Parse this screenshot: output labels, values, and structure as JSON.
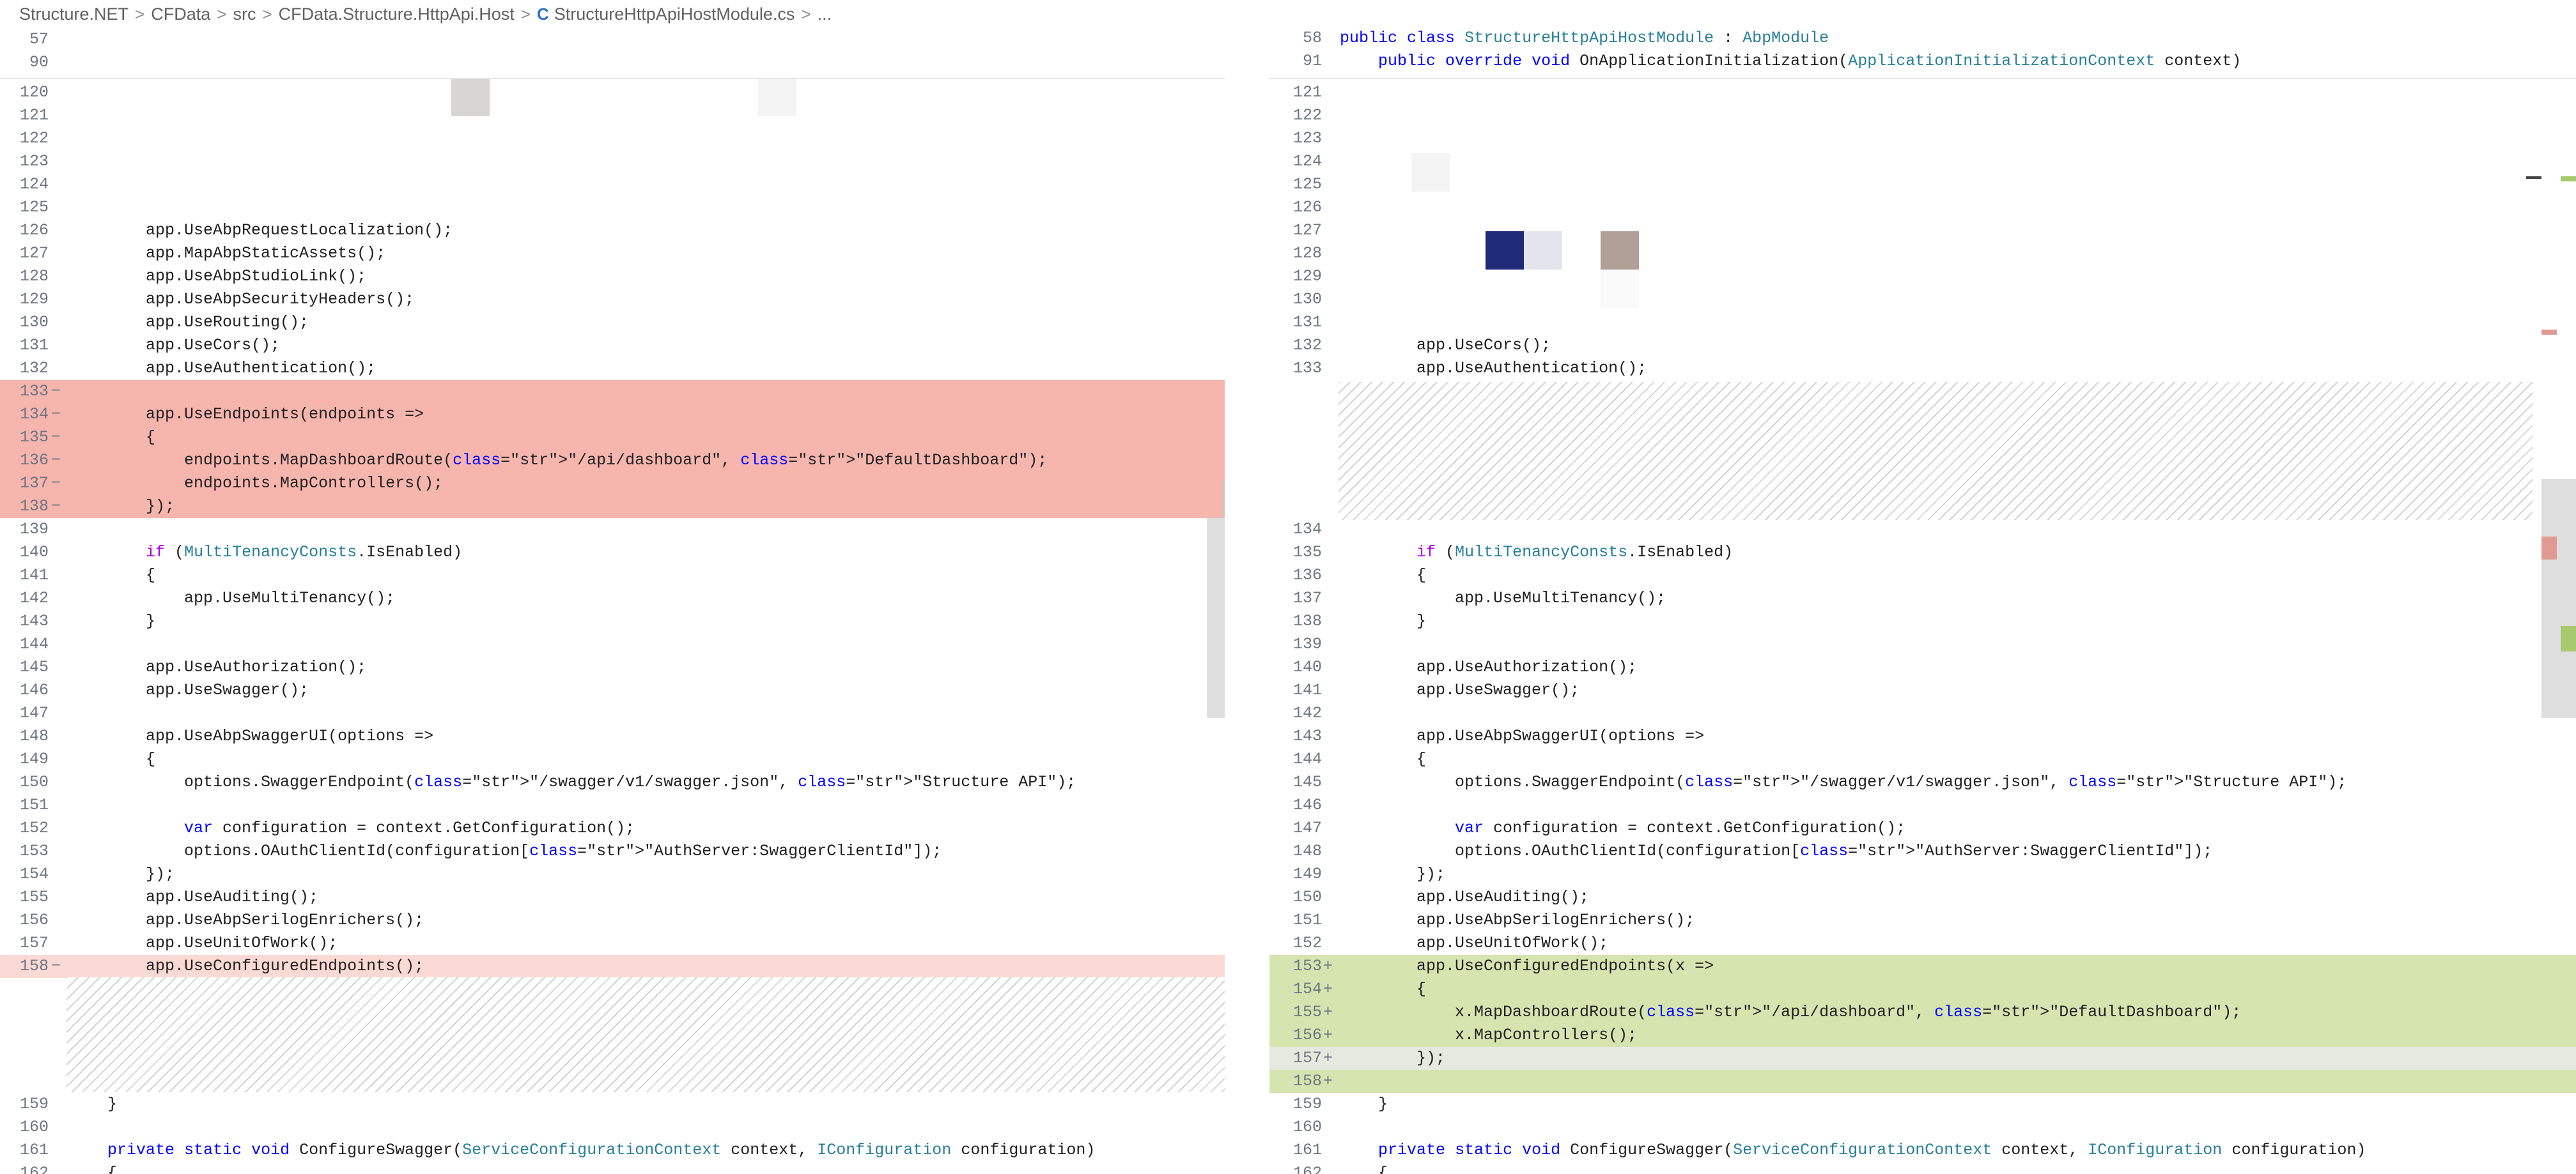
{
  "breadcrumb": {
    "items": [
      "Structure.NET",
      "CFData",
      "src",
      "CFData.Structure.HttpApi.Host",
      "StructureHttpApiHostModule.cs",
      "..."
    ],
    "separator": ">"
  },
  "left": {
    "sticky": [
      {
        "ln": "57",
        "text": ""
      },
      {
        "ln": "90",
        "text": ""
      }
    ],
    "lines": [
      {
        "ln": "120",
        "text": ""
      },
      {
        "ln": "121",
        "text": ""
      },
      {
        "ln": "122",
        "text": ""
      },
      {
        "ln": "123",
        "text": ""
      },
      {
        "ln": "124",
        "text": ""
      },
      {
        "ln": "125",
        "text": ""
      },
      {
        "ln": "126",
        "text": "        app.UseAbpRequestLocalization();"
      },
      {
        "ln": "127",
        "text": "        app.MapAbpStaticAssets();"
      },
      {
        "ln": "128",
        "text": "        app.UseAbpStudioLink();"
      },
      {
        "ln": "129",
        "text": "        app.UseAbpSecurityHeaders();"
      },
      {
        "ln": "130",
        "text": "        app.UseRouting();"
      },
      {
        "ln": "131",
        "text": "        app.UseCors();"
      },
      {
        "ln": "132",
        "text": "        app.UseAuthentication();"
      },
      {
        "ln": "133",
        "mark": "−",
        "text": "",
        "diff": "del"
      },
      {
        "ln": "134",
        "mark": "−",
        "text": "        app.UseEndpoints(endpoints =>",
        "diff": "del"
      },
      {
        "ln": "135",
        "mark": "−",
        "text": "        {",
        "diff": "del"
      },
      {
        "ln": "136",
        "mark": "−",
        "text": "            endpoints.MapDashboardRoute(\"/api/dashboard\", \"DefaultDashboard\");",
        "diff": "del"
      },
      {
        "ln": "137",
        "mark": "−",
        "text": "            endpoints.MapControllers();",
        "diff": "del"
      },
      {
        "ln": "138",
        "mark": "−",
        "text": "        });",
        "diff": "del"
      },
      {
        "ln": "139",
        "text": ""
      },
      {
        "ln": "140",
        "text": "        if (MultiTenancyConsts.IsEnabled)"
      },
      {
        "ln": "141",
        "text": "        {"
      },
      {
        "ln": "142",
        "text": "            app.UseMultiTenancy();"
      },
      {
        "ln": "143",
        "text": "        }"
      },
      {
        "ln": "144",
        "text": ""
      },
      {
        "ln": "145",
        "text": "        app.UseAuthorization();"
      },
      {
        "ln": "146",
        "text": "        app.UseSwagger();"
      },
      {
        "ln": "147",
        "text": ""
      },
      {
        "ln": "148",
        "text": "        app.UseAbpSwaggerUI(options =>"
      },
      {
        "ln": "149",
        "text": "        {"
      },
      {
        "ln": "150",
        "text": "            options.SwaggerEndpoint(\"/swagger/v1/swagger.json\", \"Structure API\");"
      },
      {
        "ln": "151",
        "text": ""
      },
      {
        "ln": "152",
        "text": "            var configuration = context.GetConfiguration();"
      },
      {
        "ln": "153",
        "text": "            options.OAuthClientId(configuration[\"AuthServer:SwaggerClientId\"]);"
      },
      {
        "ln": "154",
        "text": "        });"
      },
      {
        "ln": "155",
        "text": "        app.UseAuditing();"
      },
      {
        "ln": "156",
        "text": "        app.UseAbpSerilogEnrichers();"
      },
      {
        "ln": "157",
        "text": "        app.UseUnitOfWork();"
      },
      {
        "ln": "158",
        "mark": "−",
        "text": "        app.UseConfiguredEndpoints();",
        "diff": "del-light"
      },
      {
        "ln": "159",
        "text": "    }",
        "after_gap": true
      },
      {
        "ln": "160",
        "text": ""
      },
      {
        "ln": "161",
        "text": "    private static void ConfigureSwagger(ServiceConfigurationContext context, IConfiguration configuration)"
      },
      {
        "ln": "162",
        "text": "    {"
      }
    ]
  },
  "right": {
    "sticky": [
      {
        "ln": "58",
        "text": "public class StructureHttpApiHostModule : AbpModule"
      },
      {
        "ln": "91",
        "text": "    public override void OnApplicationInitialization(ApplicationInitializationContext context)"
      }
    ],
    "lines": [
      {
        "ln": "121",
        "text": ""
      },
      {
        "ln": "122",
        "text": ""
      },
      {
        "ln": "123",
        "text": ""
      },
      {
        "ln": "124",
        "text": ""
      },
      {
        "ln": "125",
        "text": ""
      },
      {
        "ln": "126",
        "text": ""
      },
      {
        "ln": "127",
        "text": ""
      },
      {
        "ln": "128",
        "text": ""
      },
      {
        "ln": "129",
        "text": ""
      },
      {
        "ln": "130",
        "text": ""
      },
      {
        "ln": "131",
        "text": ""
      },
      {
        "ln": "132",
        "text": "        app.UseCors();"
      },
      {
        "ln": "133",
        "text": "        app.UseAuthentication();"
      },
      {
        "ln": "134",
        "text": "",
        "after_gap": true
      },
      {
        "ln": "135",
        "text": "        if (MultiTenancyConsts.IsEnabled)"
      },
      {
        "ln": "136",
        "text": "        {"
      },
      {
        "ln": "137",
        "text": "            app.UseMultiTenancy();"
      },
      {
        "ln": "138",
        "text": "        }"
      },
      {
        "ln": "139",
        "text": ""
      },
      {
        "ln": "140",
        "text": "        app.UseAuthorization();"
      },
      {
        "ln": "141",
        "text": "        app.UseSwagger();"
      },
      {
        "ln": "142",
        "text": ""
      },
      {
        "ln": "143",
        "text": "        app.UseAbpSwaggerUI(options =>"
      },
      {
        "ln": "144",
        "text": "        {"
      },
      {
        "ln": "145",
        "text": "            options.SwaggerEndpoint(\"/swagger/v1/swagger.json\", \"Structure API\");"
      },
      {
        "ln": "146",
        "text": ""
      },
      {
        "ln": "147",
        "text": "            var configuration = context.GetConfiguration();"
      },
      {
        "ln": "148",
        "text": "            options.OAuthClientId(configuration[\"AuthServer:SwaggerClientId\"]);"
      },
      {
        "ln": "149",
        "text": "        });"
      },
      {
        "ln": "150",
        "text": "        app.UseAuditing();"
      },
      {
        "ln": "151",
        "text": "        app.UseAbpSerilogEnrichers();"
      },
      {
        "ln": "152",
        "text": "        app.UseUnitOfWork();"
      },
      {
        "ln": "153",
        "mark": "+",
        "text": "        app.UseConfiguredEndpoints(x =>",
        "diff": "ins"
      },
      {
        "ln": "154",
        "mark": "+",
        "text": "        {",
        "diff": "ins"
      },
      {
        "ln": "155",
        "mark": "+",
        "text": "            x.MapDashboardRoute(\"/api/dashboard\", \"DefaultDashboard\");",
        "diff": "ins"
      },
      {
        "ln": "156",
        "mark": "+",
        "text": "            x.MapControllers();",
        "diff": "ins"
      },
      {
        "ln": "157",
        "mark": "+",
        "text": "        });",
        "diff": "ins-light"
      },
      {
        "ln": "158",
        "mark": "+",
        "text": "",
        "diff": "ins"
      },
      {
        "ln": "159",
        "text": "    }"
      },
      {
        "ln": "160",
        "text": ""
      },
      {
        "ln": "161",
        "text": "    private static void ConfigureSwagger(ServiceConfigurationContext context, IConfiguration configuration)"
      },
      {
        "ln": "162",
        "text": "    {"
      }
    ]
  },
  "colors": {
    "deleted": "#f6b5ad",
    "deleted_light": "#fbd9d4",
    "inserted": "#d6e4b0",
    "keyword": "#0000ff",
    "string": "#a31515",
    "type": "#267f99"
  }
}
